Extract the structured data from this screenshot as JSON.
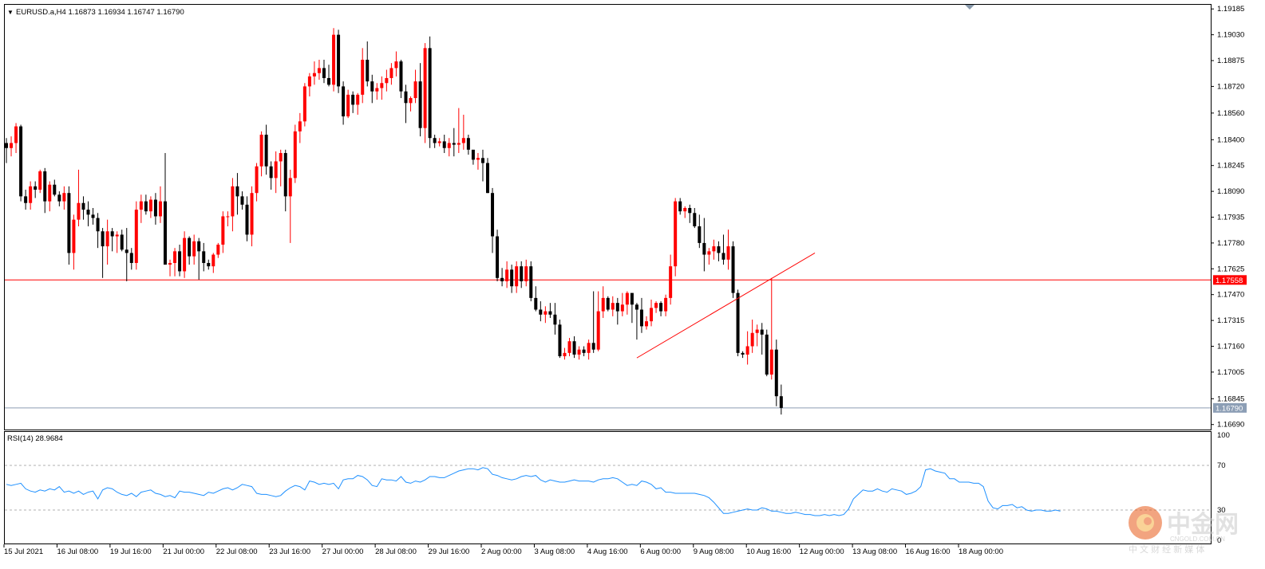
{
  "chart_data": {
    "type": "candlestick",
    "symbol_header": "EURUSD.a,H4  1.16873 1.16934 1.16747 1.16790",
    "price_axis": {
      "ylim": [
        1.1666,
        1.1921
      ],
      "tick_labels": [
        "1.19185",
        "1.19030",
        "1.18875",
        "1.18720",
        "1.18560",
        "1.18400",
        "1.18245",
        "1.18090",
        "1.17935",
        "1.17780",
        "1.17625",
        "1.17470",
        "1.17315",
        "1.17160",
        "1.17005",
        "1.16845",
        "1.16690"
      ]
    },
    "time_axis_labels": [
      "15 Jul 2021",
      "16 Jul 08:00",
      "19 Jul 16:00",
      "21 Jul 00:00",
      "22 Jul 08:00",
      "23 Jul 16:00",
      "27 Jul 00:00",
      "28 Jul 08:00",
      "29 Jul 16:00",
      "2 Aug 00:00",
      "3 Aug 08:00",
      "4 Aug 16:00",
      "6 Aug 00:00",
      "9 Aug 08:00",
      "10 Aug 16:00",
      "12 Aug 00:00",
      "13 Aug 08:00",
      "16 Aug 16:00",
      "18 Aug 00:00"
    ],
    "horizontal_lines": [
      {
        "price": 1.17558,
        "label": "1.17558",
        "color": "#ff0000"
      },
      {
        "price": 1.1679,
        "label": "1.16790",
        "color": "#8c9eb5"
      }
    ],
    "trendline": {
      "start": {
        "index": 131,
        "price": 1.1709
      },
      "end": {
        "index": 168,
        "price": 1.1772
      },
      "color": "#ff0000"
    },
    "colors": {
      "bull": "#ff0000",
      "bear": "#000000",
      "doji": "#00c000",
      "rsi_line": "#1e90ff"
    },
    "candles": [
      [
        1.1838,
        1.1841,
        1.1826,
        1.1835
      ],
      [
        1.1835,
        1.1842,
        1.183,
        1.1838
      ],
      [
        1.1838,
        1.185,
        1.1832,
        1.1848
      ],
      [
        1.1848,
        1.1849,
        1.1803,
        1.1806
      ],
      [
        1.1806,
        1.181,
        1.1798,
        1.1802
      ],
      [
        1.1802,
        1.1815,
        1.1798,
        1.1812
      ],
      [
        1.1812,
        1.1815,
        1.1805,
        1.181
      ],
      [
        1.181,
        1.1822,
        1.1808,
        1.1821
      ],
      [
        1.1821,
        1.1823,
        1.1796,
        1.1803
      ],
      [
        1.1803,
        1.1815,
        1.1797,
        1.1813
      ],
      [
        1.1813,
        1.1816,
        1.1806,
        1.1807
      ],
      [
        1.1807,
        1.1809,
        1.18,
        1.1803
      ],
      [
        1.1803,
        1.1812,
        1.1798,
        1.1808
      ],
      [
        1.1808,
        1.1812,
        1.1765,
        1.1772
      ],
      [
        1.1772,
        1.1795,
        1.1762,
        1.1792
      ],
      [
        1.1792,
        1.1822,
        1.1788,
        1.1802
      ],
      [
        1.1802,
        1.1806,
        1.1792,
        1.1798
      ],
      [
        1.1798,
        1.1803,
        1.1788,
        1.1795
      ],
      [
        1.1795,
        1.1799,
        1.1789,
        1.1793
      ],
      [
        1.1793,
        1.1796,
        1.1775,
        1.1785
      ],
      [
        1.1785,
        1.1787,
        1.1757,
        1.1776
      ],
      [
        1.1776,
        1.1792,
        1.1765,
        1.1785
      ],
      [
        1.1785,
        1.1787,
        1.1773,
        1.1782
      ],
      [
        1.1782,
        1.1785,
        1.1772,
        1.1783
      ],
      [
        1.1783,
        1.1786,
        1.1773,
        1.1774
      ],
      [
        1.1774,
        1.1787,
        1.1755,
        1.1772
      ],
      [
        1.1772,
        1.1775,
        1.1762,
        1.1766
      ],
      [
        1.1766,
        1.1803,
        1.1762,
        1.1798
      ],
      [
        1.1798,
        1.1807,
        1.179,
        1.1803
      ],
      [
        1.1803,
        1.1807,
        1.1795,
        1.1797
      ],
      [
        1.1797,
        1.1806,
        1.1793,
        1.1804
      ],
      [
        1.1804,
        1.1808,
        1.1789,
        1.1794
      ],
      [
        1.1794,
        1.1812,
        1.179,
        1.1803
      ],
      [
        1.1803,
        1.1832,
        1.1775,
        1.1765
      ],
      [
        1.1765,
        1.1768,
        1.1758,
        1.1766
      ],
      [
        1.1766,
        1.1775,
        1.1758,
        1.1773
      ],
      [
        1.1773,
        1.1777,
        1.1758,
        1.1761
      ],
      [
        1.1761,
        1.1785,
        1.1757,
        1.1781
      ],
      [
        1.1781,
        1.1782,
        1.1765,
        1.177
      ],
      [
        1.177,
        1.1783,
        1.1765,
        1.1779
      ],
      [
        1.1779,
        1.1781,
        1.1756,
        1.1773
      ],
      [
        1.1773,
        1.1778,
        1.1761,
        1.1766
      ],
      [
        1.1766,
        1.1768,
        1.1762,
        1.1764
      ],
      [
        1.1764,
        1.1772,
        1.176,
        1.1771
      ],
      [
        1.1771,
        1.1778,
        1.1769,
        1.1777
      ],
      [
        1.1777,
        1.1797,
        1.1772,
        1.1794
      ],
      [
        1.1794,
        1.1797,
        1.1788,
        1.1794
      ],
      [
        1.1794,
        1.1817,
        1.1785,
        1.1812
      ],
      [
        1.1812,
        1.182,
        1.1795,
        1.1806
      ],
      [
        1.1806,
        1.1809,
        1.1798,
        1.1801
      ],
      [
        1.1801,
        1.1806,
        1.1779,
        1.1783
      ],
      [
        1.1783,
        1.1812,
        1.1776,
        1.1808
      ],
      [
        1.1808,
        1.1826,
        1.1803,
        1.1824
      ],
      [
        1.1824,
        1.1845,
        1.1818,
        1.1843
      ],
      [
        1.1843,
        1.1849,
        1.1819,
        1.1824
      ],
      [
        1.1824,
        1.1827,
        1.181,
        1.1817
      ],
      [
        1.1817,
        1.1833,
        1.1808,
        1.1827
      ],
      [
        1.1827,
        1.1834,
        1.1812,
        1.1832
      ],
      [
        1.1832,
        1.1834,
        1.1797,
        1.1806
      ],
      [
        1.1806,
        1.1822,
        1.1778,
        1.1817
      ],
      [
        1.1817,
        1.1849,
        1.1814,
        1.1845
      ],
      [
        1.1845,
        1.1856,
        1.1838,
        1.1851
      ],
      [
        1.1851,
        1.1874,
        1.1848,
        1.1872
      ],
      [
        1.1872,
        1.188,
        1.1866,
        1.1878
      ],
      [
        1.1878,
        1.1887,
        1.1873,
        1.188
      ],
      [
        1.188,
        1.1888,
        1.1876,
        1.1883
      ],
      [
        1.1883,
        1.1888,
        1.1874,
        1.1877
      ],
      [
        1.1877,
        1.1885,
        1.1872,
        1.1873
      ],
      [
        1.1873,
        1.1907,
        1.1869,
        1.1903
      ],
      [
        1.1903,
        1.1906,
        1.1868,
        1.1872
      ],
      [
        1.1872,
        1.1875,
        1.1849,
        1.1854
      ],
      [
        1.1854,
        1.187,
        1.1853,
        1.1867
      ],
      [
        1.1867,
        1.1869,
        1.1856,
        1.1861
      ],
      [
        1.1861,
        1.1868,
        1.1855,
        1.1867
      ],
      [
        1.1867,
        1.1895,
        1.1862,
        1.1888
      ],
      [
        1.1888,
        1.1899,
        1.1872,
        1.1875
      ],
      [
        1.1875,
        1.1879,
        1.1862,
        1.1869
      ],
      [
        1.1869,
        1.1874,
        1.1864,
        1.1871
      ],
      [
        1.1871,
        1.1878,
        1.1864,
        1.1874
      ],
      [
        1.1874,
        1.1882,
        1.1869,
        1.1877
      ],
      [
        1.1877,
        1.1886,
        1.1873,
        1.1883
      ],
      [
        1.1883,
        1.1893,
        1.1878,
        1.1887
      ],
      [
        1.1887,
        1.1888,
        1.1865,
        1.1869
      ],
      [
        1.1869,
        1.1873,
        1.185,
        1.1862
      ],
      [
        1.1862,
        1.1866,
        1.1857,
        1.1865
      ],
      [
        1.1865,
        1.1882,
        1.1862,
        1.1875
      ],
      [
        1.1875,
        1.1886,
        1.1842,
        1.1847
      ],
      [
        1.1847,
        1.1898,
        1.1838,
        1.1895
      ],
      [
        1.1895,
        1.1902,
        1.1835,
        1.1841
      ],
      [
        1.1841,
        1.1843,
        1.1835,
        1.1838
      ],
      [
        1.1838,
        1.1841,
        1.1836,
        1.1839
      ],
      [
        1.1839,
        1.1843,
        1.1832,
        1.1835
      ],
      [
        1.1835,
        1.1841,
        1.183,
        1.1838
      ],
      [
        1.1838,
        1.1847,
        1.183,
        1.1837
      ],
      [
        1.1837,
        1.1859,
        1.1832,
        1.1838
      ],
      [
        1.1838,
        1.1855,
        1.1834,
        1.1841
      ],
      [
        1.1841,
        1.1843,
        1.1831,
        1.1834
      ],
      [
        1.1834,
        1.1833,
        1.1825,
        1.1828
      ],
      [
        1.1828,
        1.1832,
        1.1822,
        1.1829
      ],
      [
        1.1829,
        1.1834,
        1.1815,
        1.1826
      ],
      [
        1.1826,
        1.1829,
        1.1808,
        1.1808
      ],
      [
        1.1808,
        1.1811,
        1.1772,
        1.1782
      ],
      [
        1.1782,
        1.1786,
        1.1755,
        1.1757
      ],
      [
        1.1757,
        1.1763,
        1.1752,
        1.1755
      ],
      [
        1.1755,
        1.1767,
        1.1751,
        1.1762
      ],
      [
        1.1762,
        1.1765,
        1.1748,
        1.1752
      ],
      [
        1.1752,
        1.1767,
        1.1748,
        1.1764
      ],
      [
        1.1764,
        1.1767,
        1.1751,
        1.1755
      ],
      [
        1.1755,
        1.1768,
        1.1752,
        1.1764
      ],
      [
        1.1764,
        1.1767,
        1.1743,
        1.1745
      ],
      [
        1.1745,
        1.1752,
        1.1737,
        1.1738
      ],
      [
        1.1738,
        1.1743,
        1.1731,
        1.1735
      ],
      [
        1.1735,
        1.174,
        1.173,
        1.1737
      ],
      [
        1.1737,
        1.1742,
        1.1733,
        1.1735
      ],
      [
        1.1735,
        1.1742,
        1.1723,
        1.1729
      ],
      [
        1.1729,
        1.1732,
        1.1709,
        1.171
      ],
      [
        1.171,
        1.1715,
        1.1708,
        1.1712
      ],
      [
        1.1712,
        1.1721,
        1.171,
        1.1719
      ],
      [
        1.1719,
        1.1722,
        1.1709,
        1.1711
      ],
      [
        1.1711,
        1.1716,
        1.1708,
        1.1714
      ],
      [
        1.1714,
        1.1716,
        1.171,
        1.1712
      ],
      [
        1.1712,
        1.172,
        1.1708,
        1.1718
      ],
      [
        1.1718,
        1.1749,
        1.1712,
        1.1714
      ],
      [
        1.1714,
        1.1749,
        1.1713,
        1.1737
      ],
      [
        1.1737,
        1.1752,
        1.1733,
        1.1745
      ],
      [
        1.1745,
        1.1746,
        1.1737,
        1.1738
      ],
      [
        1.1738,
        1.1746,
        1.1734,
        1.1742
      ],
      [
        1.1742,
        1.1745,
        1.1729,
        1.1737
      ],
      [
        1.1737,
        1.1748,
        1.1734,
        1.1741
      ],
      [
        1.1741,
        1.1749,
        1.1735,
        1.1748
      ],
      [
        1.1748,
        1.1747,
        1.173,
        1.1741
      ],
      [
        1.1741,
        1.1742,
        1.172,
        1.1738
      ],
      [
        1.1738,
        1.1745,
        1.1724,
        1.1728
      ],
      [
        1.1728,
        1.1734,
        1.1726,
        1.1731
      ],
      [
        1.1731,
        1.1744,
        1.1728,
        1.1739
      ],
      [
        1.1739,
        1.1743,
        1.1736,
        1.1742
      ],
      [
        1.1742,
        1.1743,
        1.1734,
        1.1737
      ],
      [
        1.1737,
        1.1747,
        1.1734,
        1.1745
      ],
      [
        1.1745,
        1.1771,
        1.1741,
        1.1764
      ],
      [
        1.1764,
        1.1805,
        1.1758,
        1.1803
      ],
      [
        1.1803,
        1.1805,
        1.1795,
        1.1797
      ],
      [
        1.1797,
        1.18,
        1.1793,
        1.1799
      ],
      [
        1.1799,
        1.1801,
        1.179,
        1.1796
      ],
      [
        1.1796,
        1.1799,
        1.1787,
        1.1788
      ],
      [
        1.1788,
        1.1795,
        1.1775,
        1.1778
      ],
      [
        1.1778,
        1.1793,
        1.1761,
        1.1771
      ],
      [
        1.1771,
        1.1775,
        1.1765,
        1.1773
      ],
      [
        1.1773,
        1.178,
        1.1768,
        1.1776
      ],
      [
        1.1776,
        1.1779,
        1.1767,
        1.1772
      ],
      [
        1.1772,
        1.1783,
        1.1765,
        1.1768
      ],
      [
        1.1768,
        1.1786,
        1.1762,
        1.1776
      ],
      [
        1.1776,
        1.1779,
        1.1745,
        1.1748
      ],
      [
        1.1748,
        1.175,
        1.171,
        1.1712
      ],
      [
        1.1712,
        1.1713,
        1.1709,
        1.1711
      ],
      [
        1.1711,
        1.1725,
        1.1705,
        1.1716
      ],
      [
        1.1716,
        1.1732,
        1.1712,
        1.1724
      ],
      [
        1.1724,
        1.1729,
        1.1716,
        1.1726
      ],
      [
        1.1726,
        1.173,
        1.1711,
        1.1723
      ],
      [
        1.1723,
        1.1726,
        1.1698,
        1.1699
      ],
      [
        1.1699,
        1.1757,
        1.1696,
        1.1714
      ],
      [
        1.1714,
        1.172,
        1.168,
        1.1686
      ],
      [
        1.1686,
        1.1693,
        1.1675,
        1.1679
      ]
    ],
    "rsi": {
      "label": "RSI(14) 28.9684",
      "levels": [
        70,
        30
      ],
      "scale_labels": [
        "100",
        "70",
        "30",
        "0"
      ],
      "values": [
        53,
        52,
        53,
        54,
        49,
        47,
        46,
        48,
        47,
        49,
        48,
        51,
        46,
        47,
        45,
        47,
        44,
        46,
        47,
        40,
        48,
        50,
        49,
        46,
        44,
        43,
        45,
        42,
        46,
        47,
        48,
        45,
        44,
        42,
        43,
        41,
        47,
        46,
        46,
        45,
        44,
        43,
        46,
        45,
        47,
        49,
        50,
        48,
        50,
        53,
        52,
        51,
        45,
        44,
        44,
        43,
        42,
        43,
        47,
        50,
        52,
        51,
        48,
        56,
        55,
        53,
        54,
        53,
        54,
        49,
        57,
        58,
        58,
        61,
        60,
        57,
        52,
        51,
        58,
        57,
        57,
        56,
        60,
        55,
        54,
        56,
        55,
        57,
        60,
        60,
        59,
        59,
        61,
        63,
        65,
        66,
        67,
        67,
        66,
        68,
        67,
        62,
        61,
        59,
        58,
        57,
        58,
        60,
        61,
        60,
        61,
        57,
        55,
        57,
        56,
        55,
        55,
        56,
        57,
        56,
        56,
        56,
        55,
        57,
        58,
        58,
        59,
        58,
        55,
        52,
        53,
        52,
        56,
        55,
        53,
        49,
        50,
        46,
        46,
        45,
        45,
        45,
        45,
        45,
        44,
        43,
        41,
        37,
        32,
        27,
        27,
        28,
        29,
        30,
        31,
        30,
        30,
        32,
        31,
        29,
        29,
        28,
        27,
        27,
        28,
        27,
        26,
        26,
        25,
        25,
        26,
        25,
        26,
        25,
        26,
        31,
        40,
        44,
        48,
        47,
        47,
        49,
        47,
        46,
        49,
        48,
        47,
        44,
        45,
        47,
        51,
        66,
        67,
        65,
        64,
        63,
        58,
        58,
        55,
        55,
        55,
        54,
        54,
        51,
        38,
        32,
        31,
        34,
        34,
        35,
        32,
        33,
        30,
        29,
        30,
        30,
        29,
        29,
        30,
        28.97
      ]
    }
  },
  "watermark": {
    "cn_name": "中金网",
    "domain_text": "CNGOLD.COM.CN",
    "slogan": "中 文 财 经 新 媒 体"
  }
}
